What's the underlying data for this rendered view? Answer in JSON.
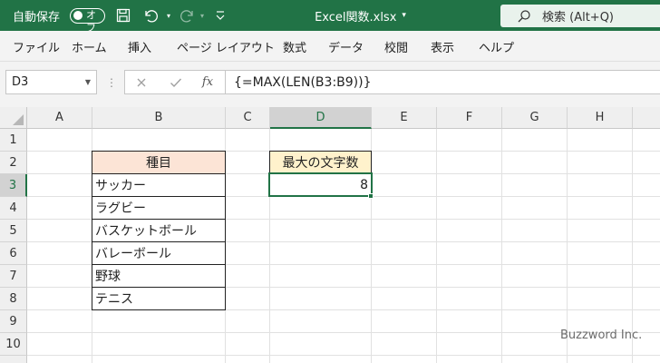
{
  "titlebar": {
    "autosave_label": "自動保存",
    "autosave_state": "オフ",
    "document_title": "Excel関数.xlsx",
    "search_placeholder": "検索 (Alt+Q)",
    "accent_color": "#217346"
  },
  "menu": {
    "items": [
      "ファイル",
      "ホーム",
      "挿入",
      "ページ レイアウト",
      "数式",
      "データ",
      "校閲",
      "表示",
      "ヘルプ"
    ]
  },
  "formula_bar": {
    "name_box": "D3",
    "fx_label": "fx",
    "formula": "{=MAX(LEN(B3:B9))}"
  },
  "sheet": {
    "columns": [
      "A",
      "B",
      "C",
      "D",
      "E",
      "F",
      "G",
      "H"
    ],
    "rows": [
      "1",
      "2",
      "3",
      "4",
      "5",
      "6",
      "7",
      "8",
      "9",
      "10"
    ],
    "selected_column": "D",
    "selected_row": "3",
    "b_header": "種目",
    "b_items": [
      "サッカー",
      "ラグビー",
      "バスケットボール",
      "バレーボール",
      "野球",
      "テニス"
    ],
    "d_header": "最大の文字数",
    "d_value": "8"
  },
  "watermark": "Buzzword Inc."
}
